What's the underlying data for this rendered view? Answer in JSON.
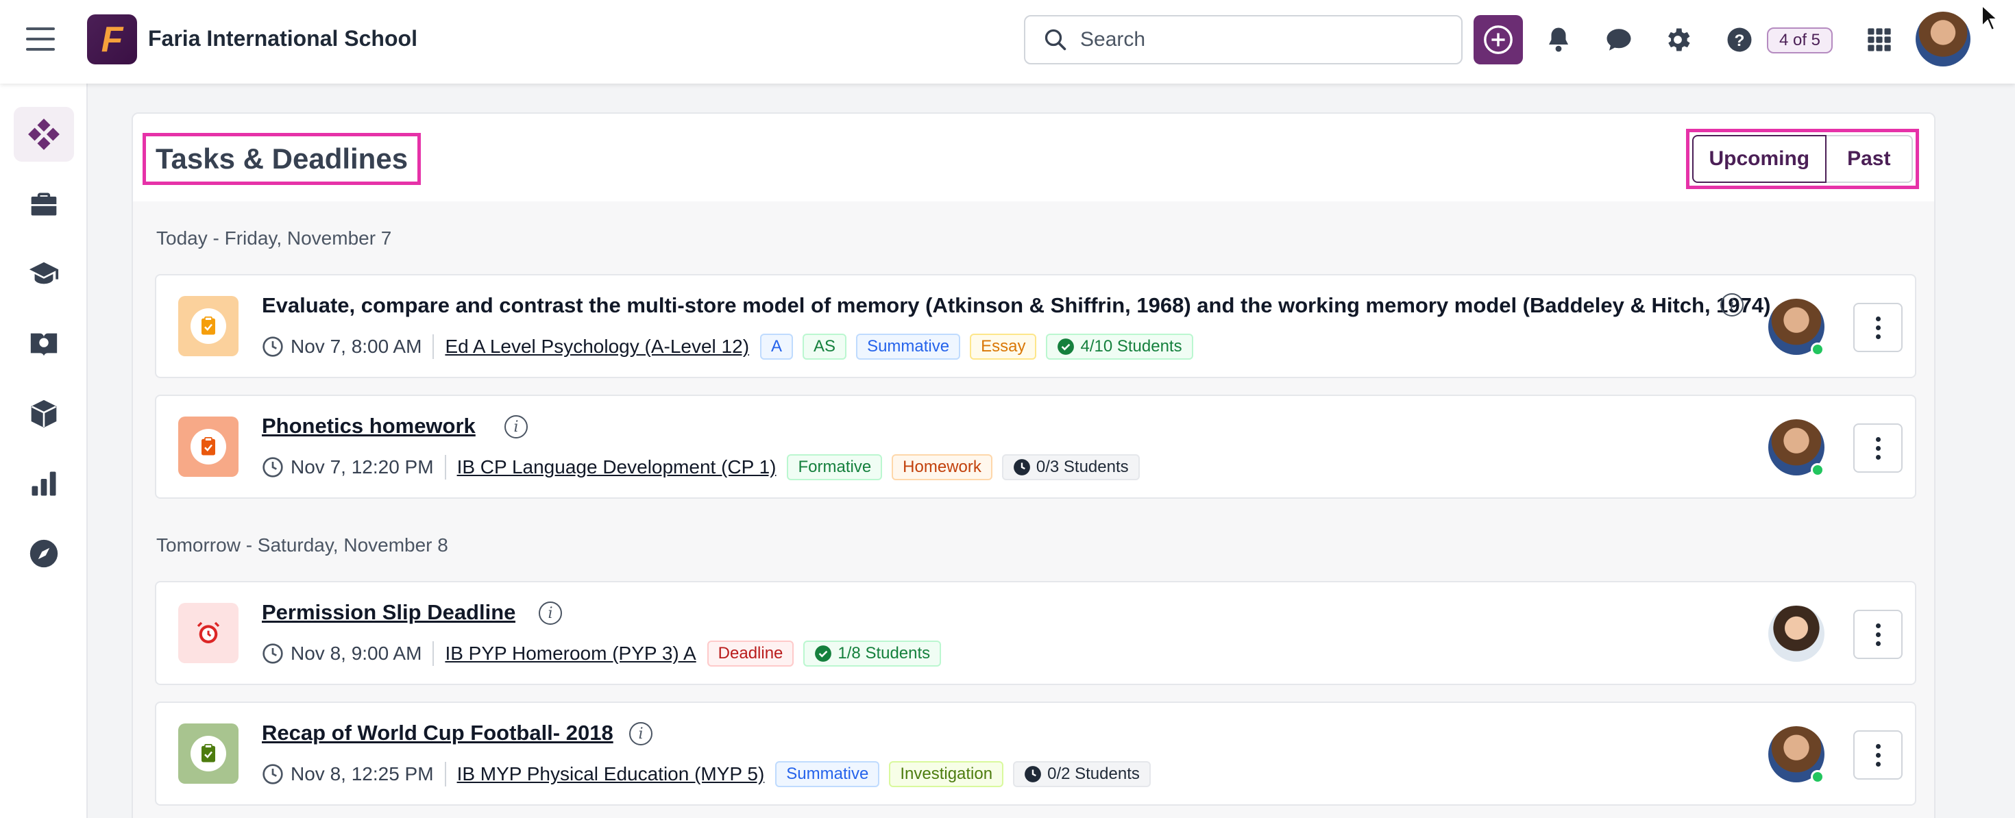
{
  "header": {
    "school_name": "Faria International School",
    "logo_letter": "F",
    "search_placeholder": "Search",
    "progress_badge": "4 of 5"
  },
  "sidebar": {
    "items": [
      {
        "icon": "dashboard-icon",
        "active": true
      },
      {
        "icon": "briefcase-icon"
      },
      {
        "icon": "graduation-cap-icon"
      },
      {
        "icon": "book-globe-icon"
      },
      {
        "icon": "cube-icon"
      },
      {
        "icon": "bar-chart-icon"
      },
      {
        "icon": "compass-icon"
      }
    ]
  },
  "page": {
    "title": "Tasks & Deadlines",
    "toggle": {
      "upcoming": "Upcoming",
      "past": "Past",
      "selected": "Upcoming"
    }
  },
  "groups": [
    {
      "label": "Today - Friday, November 7",
      "tasks": [
        {
          "title": "Evaluate, compare and contrast the multi-store model of memory (Atkinson & Shiffrin, 1968) and the working memory model (Baddeley & Hitch, 1974)",
          "datetime": "Nov 7, 8:00 AM",
          "course": "Ed A Level Psychology (A-Level 12)",
          "tags": [
            "A",
            "AS",
            "Summative",
            "Essay"
          ],
          "students": "4/10 Students"
        },
        {
          "title": "Phonetics homework",
          "datetime": "Nov 7, 12:20 PM",
          "course": "IB CP Language Development (CP 1)",
          "tags": [
            "Formative",
            "Homework"
          ],
          "students": "0/3 Students"
        }
      ]
    },
    {
      "label": "Tomorrow - Saturday, November 8",
      "tasks": [
        {
          "title": "Permission Slip Deadline",
          "datetime": "Nov 8, 9:00 AM",
          "course": "IB PYP Homeroom (PYP 3) A",
          "tags": [
            "Deadline"
          ],
          "students": "1/8 Students"
        },
        {
          "title": "Recap of World Cup Football- 2018",
          "datetime": "Nov 8, 12:25 PM",
          "course": "IB MYP Physical Education (MYP 5)",
          "tags": [
            "Summative",
            "Investigation"
          ],
          "students": "0/2 Students"
        }
      ]
    }
  ],
  "colors": {
    "brand": "#4b1f56",
    "highlight": "#e632a8",
    "add_button": "#6b2d73"
  }
}
